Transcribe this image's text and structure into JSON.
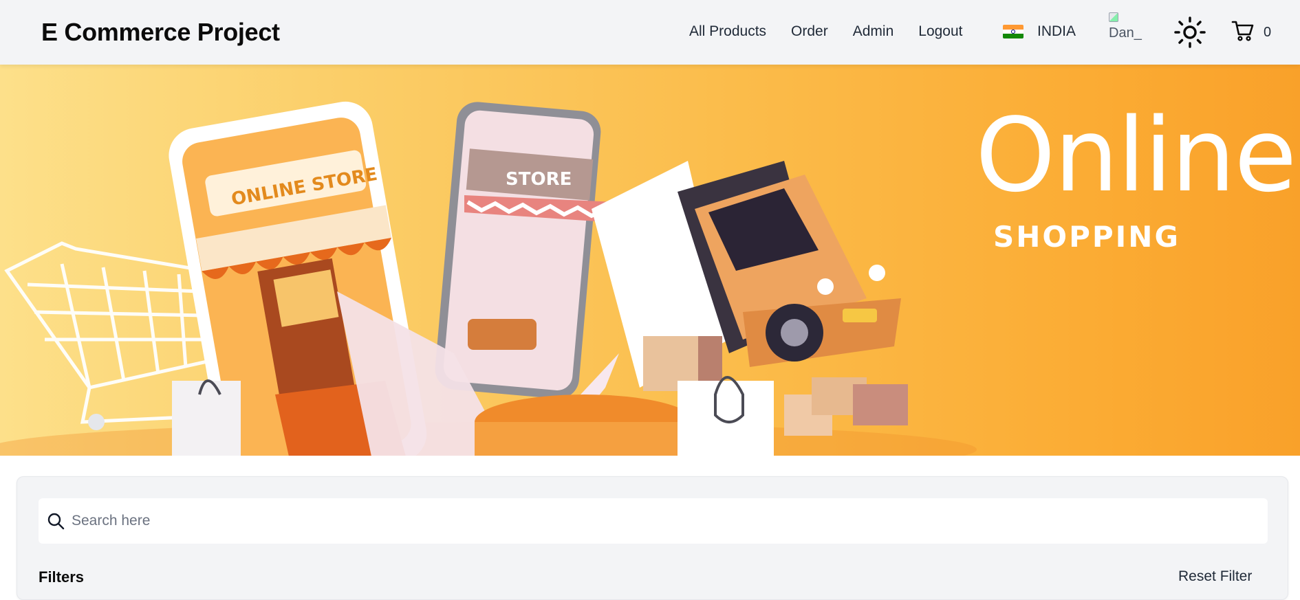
{
  "app": {
    "brand": "E Commerce Project"
  },
  "nav": {
    "links": [
      "All Products",
      "Order",
      "Admin",
      "Logout"
    ],
    "country": "INDIA",
    "avatar_alt": "Dan_",
    "cart_count": "0"
  },
  "banner": {
    "headline": "Online.",
    "subline": "SHOPPING",
    "store_sign": "ONLINE STORE",
    "phone_sign": "STORE"
  },
  "filters": {
    "search_placeholder": "Search here",
    "title": "Filters",
    "reset_label": "Reset Filter"
  },
  "colors": {
    "accent_orange": "#f9a12a",
    "navbar_bg": "#f3f4f6"
  },
  "icons": [
    "search-icon",
    "sun-icon",
    "cart-icon",
    "india-flag-icon"
  ]
}
